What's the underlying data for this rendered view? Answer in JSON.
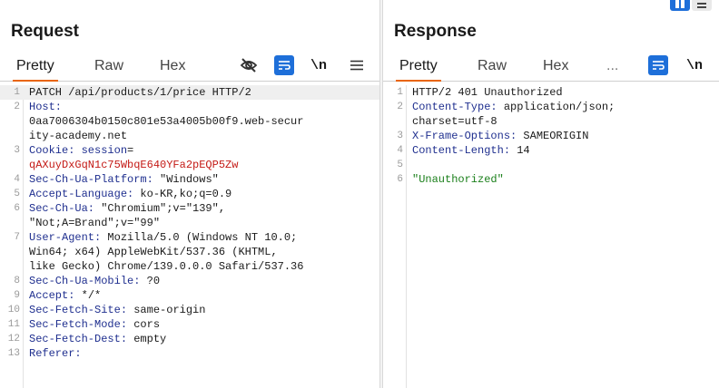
{
  "request": {
    "title": "Request",
    "tabs": [
      "Pretty",
      "Raw",
      "Hex"
    ],
    "tools": {
      "hide_icon": "eye-slash-icon",
      "wrap_icon": "wrap-lines-icon",
      "newline_label": "\\n",
      "menu_icon": "hamburger-menu-icon"
    },
    "lines": [
      {
        "n": "1",
        "parts": [
          {
            "t": "PATCH /api/products/1/price HTTP/2",
            "c": "p"
          }
        ],
        "highlight": true
      },
      {
        "n": "2",
        "parts": [
          {
            "t": "Host:",
            "c": "k"
          }
        ]
      },
      {
        "n": "",
        "parts": [
          {
            "t": "0aa7006304b0150c801e53a4005b00f9.web-secur",
            "c": "p"
          }
        ]
      },
      {
        "n": "",
        "parts": [
          {
            "t": "ity-academy.net",
            "c": "p"
          }
        ]
      },
      {
        "n": "3",
        "parts": [
          {
            "t": "Cookie: ",
            "c": "k"
          },
          {
            "t": "session",
            "c": "k"
          },
          {
            "t": "=",
            "c": "p"
          }
        ]
      },
      {
        "n": "",
        "parts": [
          {
            "t": "qAXuyDxGqN1c75WbqE640YFa2pEQP5Zw",
            "c": "r"
          }
        ]
      },
      {
        "n": "4",
        "parts": [
          {
            "t": "Sec-Ch-Ua-Platform:",
            "c": "k"
          },
          {
            "t": " \"Windows\"",
            "c": "p"
          }
        ]
      },
      {
        "n": "5",
        "parts": [
          {
            "t": "Accept-Language:",
            "c": "k"
          },
          {
            "t": " ko-KR,ko;q=0.9",
            "c": "p"
          }
        ]
      },
      {
        "n": "6",
        "parts": [
          {
            "t": "Sec-Ch-Ua:",
            "c": "k"
          },
          {
            "t": " \"Chromium\";v=\"139\",",
            "c": "p"
          }
        ]
      },
      {
        "n": "",
        "parts": [
          {
            "t": "\"Not;A=Brand\";v=\"99\"",
            "c": "p"
          }
        ]
      },
      {
        "n": "7",
        "parts": [
          {
            "t": "User-Agent:",
            "c": "k"
          },
          {
            "t": " Mozilla/5.0 (Windows NT 10.0;",
            "c": "p"
          }
        ]
      },
      {
        "n": "",
        "parts": [
          {
            "t": "Win64; x64) AppleWebKit/537.36 (KHTML,",
            "c": "p"
          }
        ]
      },
      {
        "n": "",
        "parts": [
          {
            "t": "like Gecko) Chrome/139.0.0.0 Safari/537.36",
            "c": "p"
          }
        ]
      },
      {
        "n": "8",
        "parts": [
          {
            "t": "Sec-Ch-Ua-Mobile:",
            "c": "k"
          },
          {
            "t": " ?0",
            "c": "p"
          }
        ]
      },
      {
        "n": "9",
        "parts": [
          {
            "t": "Accept:",
            "c": "k"
          },
          {
            "t": " */*",
            "c": "p"
          }
        ]
      },
      {
        "n": "10",
        "parts": [
          {
            "t": "Sec-Fetch-Site:",
            "c": "k"
          },
          {
            "t": " same-origin",
            "c": "p"
          }
        ]
      },
      {
        "n": "11",
        "parts": [
          {
            "t": "Sec-Fetch-Mode:",
            "c": "k"
          },
          {
            "t": " cors",
            "c": "p"
          }
        ]
      },
      {
        "n": "12",
        "parts": [
          {
            "t": "Sec-Fetch-Dest:",
            "c": "k"
          },
          {
            "t": " empty",
            "c": "p"
          }
        ]
      },
      {
        "n": "13",
        "parts": [
          {
            "t": "Referer:",
            "c": "k"
          }
        ]
      }
    ]
  },
  "response": {
    "title": "Response",
    "tabs": [
      "Pretty",
      "Raw",
      "Hex",
      "..."
    ],
    "tools": {
      "wrap_icon": "wrap-lines-icon",
      "newline_label": "\\n"
    },
    "view_toggle": {
      "split_icon": "split-view-icon",
      "stack_icon": "stacked-view-icon"
    },
    "lines": [
      {
        "n": "1",
        "parts": [
          {
            "t": "HTTP/2 401 Unauthorized",
            "c": "p"
          }
        ]
      },
      {
        "n": "2",
        "parts": [
          {
            "t": "Content-Type:",
            "c": "k"
          },
          {
            "t": " application/json;",
            "c": "p"
          }
        ]
      },
      {
        "n": "",
        "parts": [
          {
            "t": "charset=utf-8",
            "c": "p"
          }
        ]
      },
      {
        "n": "3",
        "parts": [
          {
            "t": "X-Frame-Options:",
            "c": "k"
          },
          {
            "t": " SAMEORIGIN",
            "c": "p"
          }
        ]
      },
      {
        "n": "4",
        "parts": [
          {
            "t": "Content-Length:",
            "c": "k"
          },
          {
            "t": " 14",
            "c": "p"
          }
        ]
      },
      {
        "n": "5",
        "parts": []
      },
      {
        "n": "6",
        "parts": [
          {
            "t": "\"Unauthorized\"",
            "c": "s"
          }
        ]
      }
    ]
  },
  "colors": {
    "accent": "#e8650c",
    "button_blue": "#1e6fd9",
    "header_key": "#1f2f8f",
    "cookie_value": "#c41a16",
    "string": "#1a7f1a"
  }
}
